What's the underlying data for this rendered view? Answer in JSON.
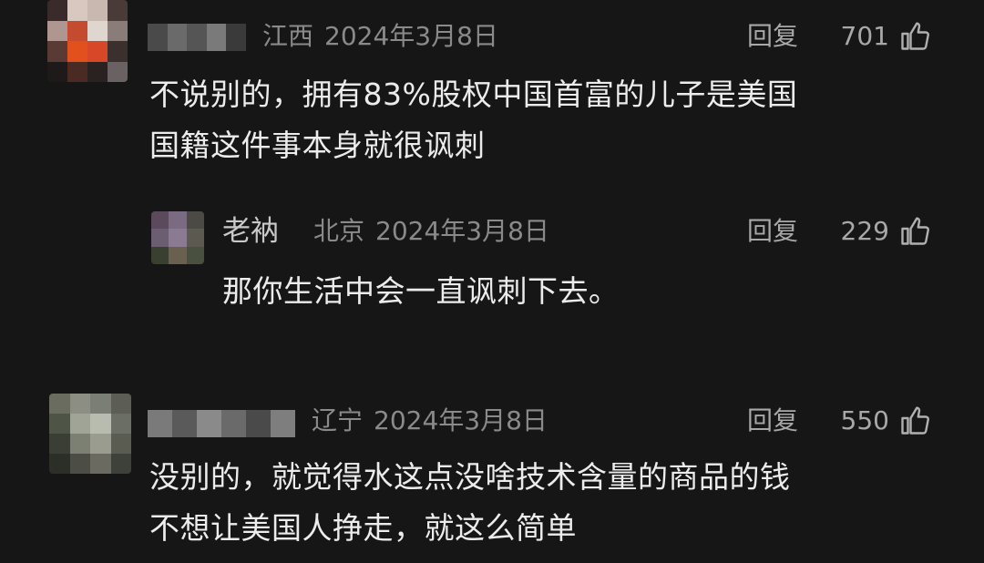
{
  "comments": [
    {
      "location": "江西",
      "date": "2024年3月8日",
      "reply_label": "回复",
      "likes": "701",
      "lines": [
        "不说别的，拥有83%股权中国首富的儿子是美国",
        "国籍这件事本身就很讽刺"
      ]
    },
    {
      "name": "老衲",
      "location": "北京",
      "date": "2024年3月8日",
      "reply_label": "回复",
      "likes": "229",
      "lines": [
        "那你生活中会一直讽刺下去。"
      ]
    },
    {
      "location": "辽宁",
      "date": "2024年3月8日",
      "reply_label": "回复",
      "likes": "550",
      "lines": [
        "没别的，就觉得水这点没啥技术含量的商品的钱",
        "不想让美国人挣走，就这么简单"
      ]
    }
  ],
  "icons": {
    "like": "thumbs-up-icon"
  },
  "colors": {
    "background": "#161616",
    "text": "#ececec",
    "meta": "#8a8a8a"
  }
}
